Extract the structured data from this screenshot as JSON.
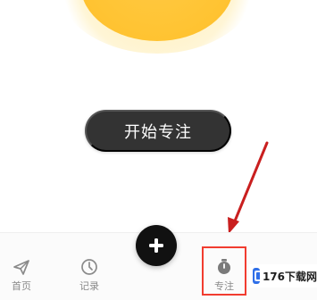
{
  "main": {
    "start_button_label": "开始专注",
    "sun_colors": {
      "core": "#ffc536",
      "glow": "#fff2c8"
    }
  },
  "fab": {
    "icon": "plus-icon",
    "color": "#111111"
  },
  "bottom_nav": {
    "items": [
      {
        "label": "首页",
        "icon": "paper-plane-icon"
      },
      {
        "label": "记录",
        "icon": "clock-icon"
      },
      {
        "label": "专注",
        "icon": "timer-icon"
      }
    ]
  },
  "annotation": {
    "arrow_color": "#c91f1f",
    "highlight_color": "#f13c2f"
  },
  "watermark": {
    "text": "176下载网",
    "badge_color": "#2f6fe8"
  }
}
